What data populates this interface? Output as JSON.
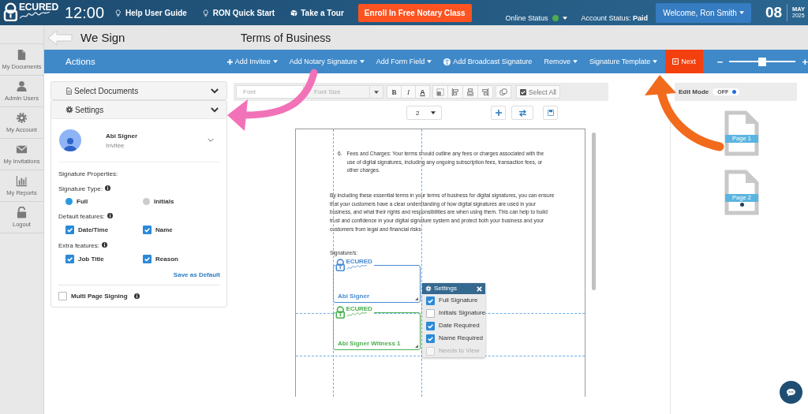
{
  "logo": {
    "word": "ECURED"
  },
  "header": {
    "time": "12:00",
    "links": [
      "Help User Guide",
      "RON Quick Start",
      "Take a Tour"
    ],
    "enroll_button": "Enroll In Free Notary Class",
    "online_status": {
      "label": "Online Status",
      "online": true
    },
    "account_status": {
      "label": "Account Status:",
      "value": "Paid"
    },
    "user_menu": "Welcome, Ron Smith",
    "date": {
      "day": "08",
      "month": "MAY",
      "year": "2025"
    }
  },
  "sidebar": {
    "items": [
      {
        "label": "My Documents"
      },
      {
        "label": "Admin Users"
      },
      {
        "label": "My Account"
      },
      {
        "label": "My Invitations"
      },
      {
        "label": "My Reports"
      },
      {
        "label": "Logout"
      }
    ]
  },
  "title_bar": {
    "app_name": "We Sign",
    "document_title": "Terms of Business"
  },
  "actions_bar": {
    "title": "Actions",
    "menu": [
      {
        "label": "Add Invitee",
        "dropdown": true
      },
      {
        "label": "Add Notary Signature",
        "dropdown": true
      },
      {
        "label": "Add Form Field",
        "dropdown": true
      },
      {
        "label": "Add Broadcast Signature",
        "dropdown": false
      },
      {
        "label": "Remove",
        "dropdown": true
      },
      {
        "label": "Signature Template",
        "dropdown": true
      }
    ],
    "next_button": "Next",
    "zoom": {
      "out": "−",
      "in": "+",
      "level": 0.5
    }
  },
  "left_panel": {
    "select_documents": "Select Documents",
    "settings_title": "Settings",
    "invitee": {
      "name": "Abi Signer",
      "role": "Invitee"
    },
    "properties_heading": "Signature Properties:",
    "signature_type": {
      "label": "Signature Type:",
      "options": [
        {
          "label": "Full",
          "selected": true
        },
        {
          "label": "Initials",
          "selected": false
        }
      ]
    },
    "default_features": {
      "label": "Default features:",
      "options": [
        {
          "label": "Date/Time",
          "checked": true
        },
        {
          "label": "Name",
          "checked": true
        }
      ]
    },
    "extra_features": {
      "label": "Extra features:",
      "options": [
        {
          "label": "Job Title",
          "checked": true
        },
        {
          "label": "Reason",
          "checked": true
        }
      ]
    },
    "save_default": "Save as Default",
    "multi_page": {
      "label": "Multi Page Signing",
      "checked": false
    }
  },
  "editor_toolbar": {
    "font_placeholder": "Font",
    "font_size_placeholder": "Font Size",
    "format_buttons": [
      "B",
      "I",
      "A"
    ],
    "select_all": "Select All"
  },
  "page_select": {
    "value": "2"
  },
  "document": {
    "list_item": {
      "number": "6.",
      "text": "Fees and Charges: Your terms should outline any fees or charges associated with the use of digital signatures, including any ongoing subscription fees, transaction fees, or other charges."
    },
    "paragraph": "By including these essential terms in your terms of business for digital signatures, you can ensure that your customers have a clear understanding of how digital signatures are used in your business, and what their rights and responsibilities are when using them. This can help to build trust and confidence in your digital signature system and protect both your business and your customers from legal and financial risks.",
    "signature_label": "Signature/s:",
    "signature_boxes": [
      {
        "logo_word": "ECURED",
        "name": "Abi Signer",
        "color": "#4a8ad0"
      },
      {
        "logo_word": "ECURED",
        "name": "Abi Signer Witness 1",
        "color": "#4caf50"
      }
    ]
  },
  "settings_popup": {
    "title": "Settings",
    "options": [
      {
        "label": "Full Signature",
        "checked": true,
        "disabled": false
      },
      {
        "label": "Initials Signature",
        "checked": false,
        "disabled": false
      },
      {
        "label": "Date Required",
        "checked": true,
        "disabled": false
      },
      {
        "label": "Name Required",
        "checked": true,
        "disabled": false
      },
      {
        "label": "Needs to View",
        "checked": false,
        "disabled": true
      }
    ]
  },
  "right_panel": {
    "edit_mode": {
      "label": "Edit Mode",
      "state_label": "OFF",
      "on": false
    },
    "pages": [
      {
        "label": "Page 1",
        "selected": false
      },
      {
        "label": "Page 2",
        "selected": true
      }
    ]
  }
}
